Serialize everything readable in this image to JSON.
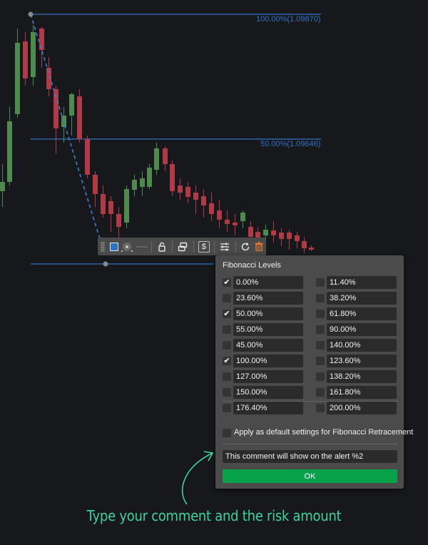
{
  "chart": {
    "fib_labels": {
      "top": "100.00%(1.09870)",
      "mid": "50.00%(1.09646)"
    },
    "colors": {
      "fib_line": "#2f72c8",
      "up_candle": "#4e8a4e",
      "down_candle": "#b03a45",
      "trend_line": "#3a7fd4",
      "anchor": "#8a8a8a"
    }
  },
  "toolbar": {
    "icons": [
      "fill-square-icon",
      "line-style-icon",
      "line-width-icon",
      "lock-icon",
      "link-icon",
      "dollar-icon",
      "settings-icon",
      "refresh-icon",
      "trash-icon"
    ],
    "dollar_label": "$"
  },
  "panel": {
    "title": "Fibonacci Levels",
    "levels_left": [
      {
        "label": "0.00%",
        "checked": true
      },
      {
        "label": "23.60%",
        "checked": false
      },
      {
        "label": "50.00%",
        "checked": true
      },
      {
        "label": "55.00%",
        "checked": false
      },
      {
        "label": "45.00%",
        "checked": false
      },
      {
        "label": "100.00%",
        "checked": true
      },
      {
        "label": "127.00%",
        "checked": false
      },
      {
        "label": "150.00%",
        "checked": false
      },
      {
        "label": "176.40%",
        "checked": false
      }
    ],
    "levels_right": [
      {
        "label": "11.40%",
        "checked": false
      },
      {
        "label": "38.20%",
        "checked": false
      },
      {
        "label": "61.80%",
        "checked": false
      },
      {
        "label": "90.00%",
        "checked": false
      },
      {
        "label": "140.00%",
        "checked": false
      },
      {
        "label": "123.60%",
        "checked": false
      },
      {
        "label": "138.20%",
        "checked": false
      },
      {
        "label": "161.80%",
        "checked": false
      },
      {
        "label": "200.00%",
        "checked": false
      }
    ],
    "default_settings_label": "Apply as default settings for Fibonacci Retracement",
    "default_settings_checked": false,
    "comment_value": "This comment will show on the alert %2",
    "ok_label": "OK"
  },
  "caption": "Type your comment and the risk amount"
}
